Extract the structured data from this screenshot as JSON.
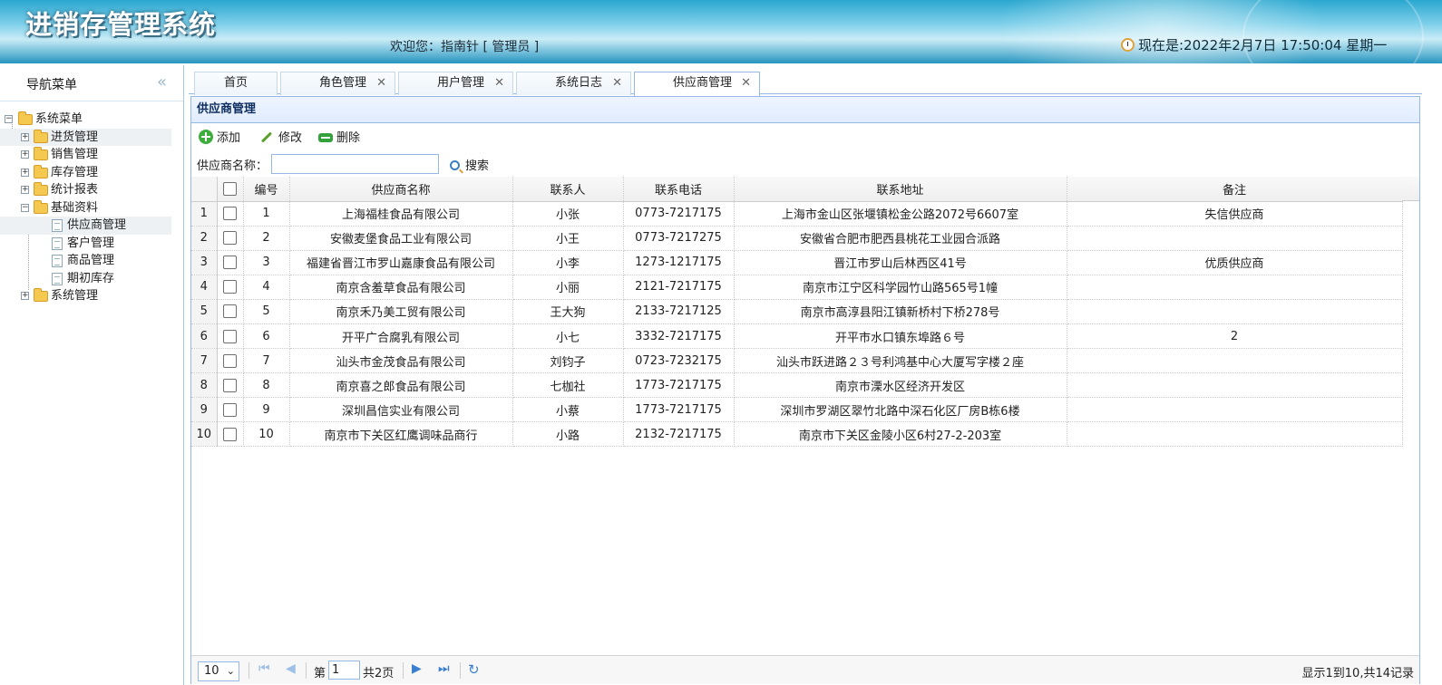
{
  "header": {
    "app_title": "进销存管理系统",
    "welcome": "欢迎您：指南针 [ 管理员 ]",
    "clock": "现在是:2022年2月7日 17:50:04 星期一"
  },
  "sidebar": {
    "title": "导航菜单",
    "tree": {
      "root": "系统菜单",
      "items": [
        "进货管理",
        "销售管理",
        "库存管理",
        "统计报表",
        "基础资料",
        "系统管理"
      ],
      "basic_children": [
        "供应商管理",
        "客户管理",
        "商品管理",
        "期初库存"
      ]
    }
  },
  "tabs": [
    {
      "label": "首页"
    },
    {
      "label": "角色管理"
    },
    {
      "label": "用户管理"
    },
    {
      "label": "系统日志"
    },
    {
      "label": "供应商管理"
    }
  ],
  "panel": {
    "title": "供应商管理",
    "toolbar": {
      "add": "添加",
      "edit": "修改",
      "delete": "删除"
    },
    "search": {
      "label": "供应商名称：",
      "value": "",
      "button": "搜索"
    }
  },
  "grid": {
    "columns": [
      "编号",
      "供应商名称",
      "联系人",
      "联系电话",
      "联系地址",
      "备注"
    ],
    "rows": [
      {
        "rn": "1",
        "id": "1",
        "name": "上海福桂食品有限公司",
        "contact": "小张",
        "phone": "0773-7217175",
        "address": "上海市金山区张堰镇松金公路2072号6607室",
        "remark": "失信供应商"
      },
      {
        "rn": "2",
        "id": "2",
        "name": "安徽麦堡食品工业有限公司",
        "contact": "小王",
        "phone": "0773-7217275",
        "address": "安徽省合肥市肥西县桃花工业园合派路",
        "remark": ""
      },
      {
        "rn": "3",
        "id": "3",
        "name": "福建省晋江市罗山嘉康食品有限公司",
        "contact": "小李",
        "phone": "1273-1217175",
        "address": "晋江市罗山后林西区41号",
        "remark": "优质供应商"
      },
      {
        "rn": "4",
        "id": "4",
        "name": "南京含羞草食品有限公司",
        "contact": "小丽",
        "phone": "2121-7217175",
        "address": "南京市江宁区科学园竹山路565号1幢",
        "remark": ""
      },
      {
        "rn": "5",
        "id": "5",
        "name": "南京禾乃美工贸有限公司",
        "contact": "王大狗",
        "phone": "2133-7217125",
        "address": "南京市高淳县阳江镇新桥村下桥278号",
        "remark": ""
      },
      {
        "rn": "6",
        "id": "6",
        "name": "开平广合腐乳有限公司",
        "contact": "小七",
        "phone": "3332-7217175",
        "address": "开平市水口镇东埠路６号",
        "remark": "2"
      },
      {
        "rn": "7",
        "id": "7",
        "name": "汕头市金茂食品有限公司",
        "contact": "刘钧子",
        "phone": "0723-7232175",
        "address": "汕头市跃进路２３号利鸿基中心大厦写字楼２座",
        "remark": ""
      },
      {
        "rn": "8",
        "id": "8",
        "name": "南京喜之郎食品有限公司",
        "contact": "七枷社",
        "phone": "1773-7217175",
        "address": "南京市溧水区经济开发区",
        "remark": ""
      },
      {
        "rn": "9",
        "id": "9",
        "name": "深圳昌信实业有限公司",
        "contact": "小蔡",
        "phone": "1773-7217175",
        "address": "深圳市罗湖区翠竹北路中深石化区厂房B栋6楼",
        "remark": ""
      },
      {
        "rn": "10",
        "id": "10",
        "name": "南京市下关区红鹰调味品商行",
        "contact": "小路",
        "phone": "2132-7217175",
        "address": "南京市下关区金陵小区6村27-2-203室",
        "remark": ""
      }
    ]
  },
  "pager": {
    "page_size": "10",
    "page_prefix": "第",
    "page_value": "1",
    "page_suffix": "共2页",
    "info": "显示1到10,共14记录"
  }
}
